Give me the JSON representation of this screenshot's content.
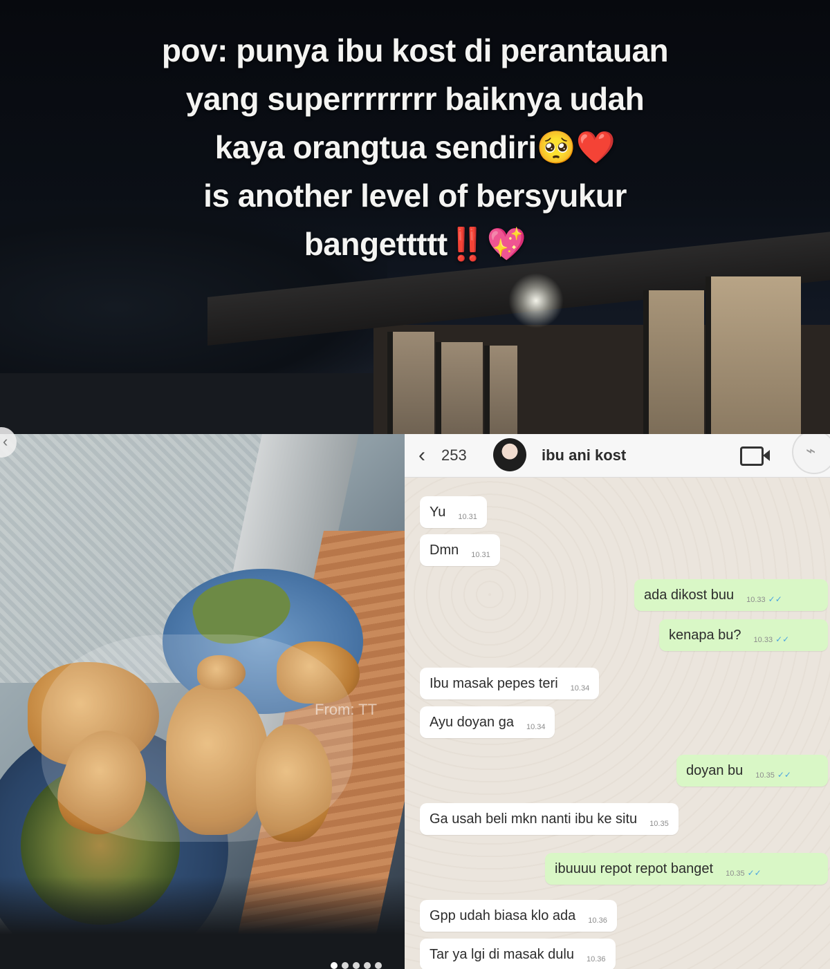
{
  "caption": {
    "text": "pov: punya ibu kost di perantauan\nyang superrrrrrrr baiknya udah\nkaya orangtua sendiri🥺❤️\nis another level of bersyukur\nbangettttt‼️💖"
  },
  "food_photo": {
    "watermark": "From: TT"
  },
  "chat": {
    "header": {
      "back_icon": "‹",
      "unread_count": "253",
      "contact_name": "ibu ani kost",
      "video_icon": "video-camera-icon"
    },
    "messages": [
      {
        "dir": "in",
        "text": "Yu",
        "time": "10.31"
      },
      {
        "dir": "in",
        "text": "Dmn",
        "time": "10.31"
      },
      {
        "dir": "out",
        "text": "ada dikost buu",
        "time": "10.33"
      },
      {
        "dir": "out",
        "text": "kenapa bu?",
        "time": "10.33"
      },
      {
        "dir": "in",
        "text": "Ibu masak pepes teri",
        "time": "10.34"
      },
      {
        "dir": "in",
        "text": "Ayu doyan ga",
        "time": "10.34"
      },
      {
        "dir": "out",
        "text": "doyan bu",
        "time": "10.35"
      },
      {
        "dir": "in",
        "text": "Ga usah beli mkn nanti ibu ke situ",
        "time": "10.35"
      },
      {
        "dir": "out",
        "text": "ibuuuu repot repot banget",
        "time": "10.35"
      },
      {
        "dir": "in",
        "text": "Gpp udah biasa klo ada",
        "time": "10.36"
      },
      {
        "dir": "in",
        "text": "Tar ya lgi di masak dulu",
        "time": "10.36"
      }
    ]
  },
  "colors": {
    "incoming_bubble": "#ffffff",
    "outgoing_bubble": "#d9f7c6",
    "chat_background": "#ebe5dd",
    "read_ticks": "#4aa3df"
  }
}
